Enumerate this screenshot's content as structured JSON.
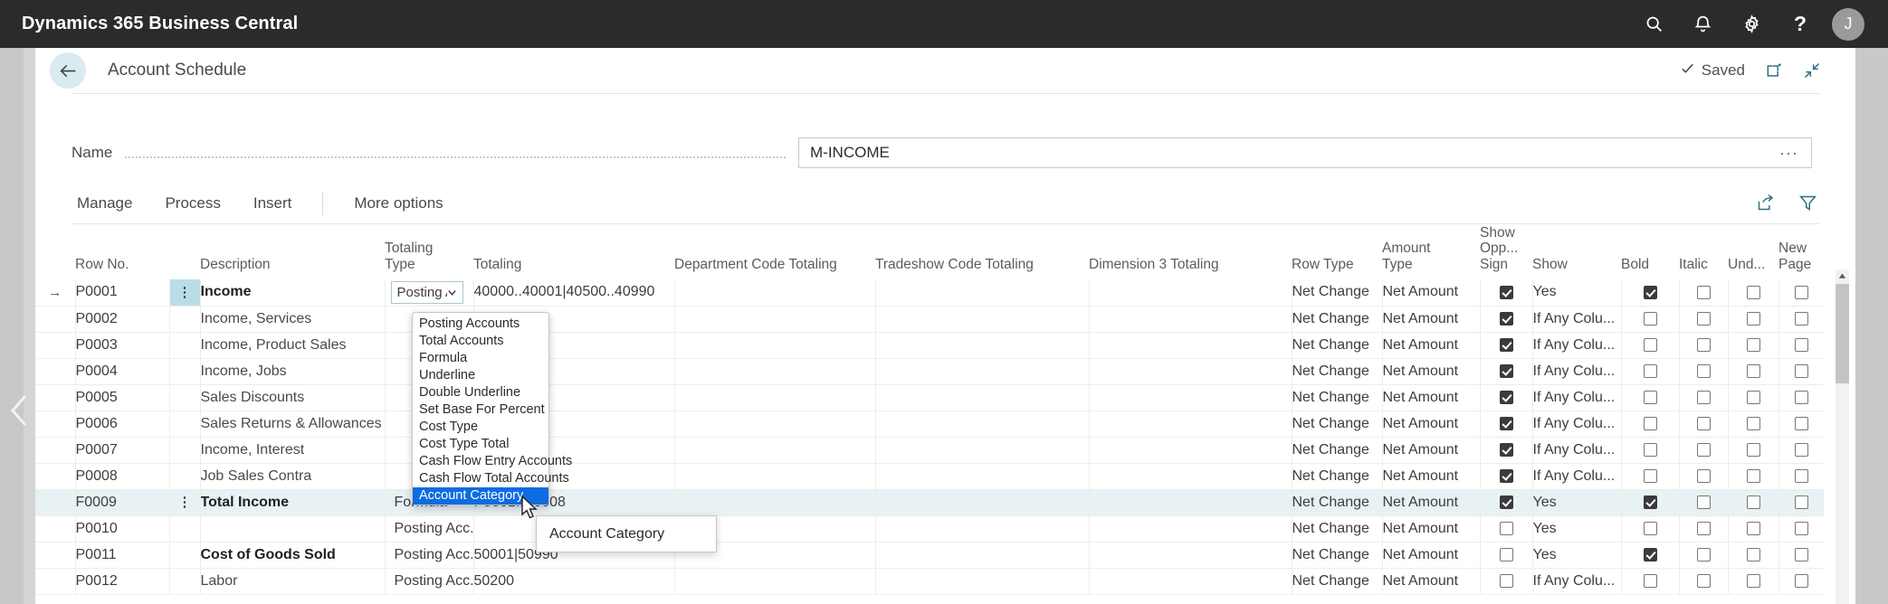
{
  "appbar": {
    "title": "Dynamics 365 Business Central",
    "icons": [
      {
        "name": "search-icon",
        "label": "Search"
      },
      {
        "name": "bell-icon",
        "label": "Notifications"
      },
      {
        "name": "gear-icon",
        "label": "Settings"
      },
      {
        "name": "help-icon",
        "label": "?"
      }
    ],
    "avatar_initial": "J",
    "background": "#2b2b2b"
  },
  "page": {
    "back_label": "Back",
    "title": "Account Schedule",
    "saved_label": "Saved",
    "open_new_window_label": "Open in new window",
    "minimize_label": "Minimize"
  },
  "name_field": {
    "label": "Name",
    "value": "M-INCOME",
    "placeholder": "",
    "ellipsis": "···"
  },
  "ribbon": {
    "items": [
      {
        "label": "Manage"
      },
      {
        "label": "Process"
      },
      {
        "label": "Insert"
      }
    ],
    "more_options": "More options",
    "right_icons": [
      {
        "name": "share-icon"
      },
      {
        "name": "filter-icon"
      }
    ]
  },
  "grid": {
    "columns": [
      {
        "key": "arrow",
        "label": ""
      },
      {
        "key": "rowno",
        "label": "Row No."
      },
      {
        "key": "kebab",
        "label": ""
      },
      {
        "key": "desc",
        "label": "Description"
      },
      {
        "key": "ttype",
        "label": "Totaling\nType"
      },
      {
        "key": "tot",
        "label": "Totaling"
      },
      {
        "key": "dept",
        "label": "Department Code Totaling"
      },
      {
        "key": "trade",
        "label": "Tradeshow Code Totaling"
      },
      {
        "key": "dim3",
        "label": "Dimension 3 Totaling"
      },
      {
        "key": "rtype",
        "label": "Row Type"
      },
      {
        "key": "atype",
        "label": "Amount\nType"
      },
      {
        "key": "showopp",
        "label": "Show\nOpp...\nSign"
      },
      {
        "key": "show",
        "label": "Show"
      },
      {
        "key": "bold",
        "label": "Bold"
      },
      {
        "key": "italic",
        "label": "Italic"
      },
      {
        "key": "und",
        "label": "Und..."
      },
      {
        "key": "newpg",
        "label": "New\nPage"
      }
    ],
    "column_labels": {
      "rowno": "Row No.",
      "desc": "Description",
      "ttype_l1": "Totaling",
      "ttype_l2": "Type",
      "tot": "Totaling",
      "dept": "Department Code Totaling",
      "trade": "Tradeshow Code Totaling",
      "dim3": "Dimension 3 Totaling",
      "rtype": "Row Type",
      "atype_l1": "Amount",
      "atype_l2": "Type",
      "showopp_l1": "Show",
      "showopp_l2": "Opp...",
      "showopp_l3": "Sign",
      "show": "Show",
      "bold": "Bold",
      "italic": "Italic",
      "und": "Und...",
      "newpg_l1": "New",
      "newpg_l2": "Page"
    },
    "rows": [
      {
        "arrow": "→",
        "rowno": "P0001",
        "kebab": true,
        "kebab_highlight": true,
        "desc": "Income",
        "bold_desc": true,
        "indent": false,
        "ttype": "Posting A",
        "ttype_combo": true,
        "tot": "40000..40001|40500..40990",
        "dept": "",
        "trade": "",
        "dim3": "",
        "rtype": "Net Change",
        "atype": "Net Amount",
        "showopp": true,
        "show": "Yes",
        "bold": true,
        "italic": false,
        "und": false,
        "newpg": false,
        "highlight": false
      },
      {
        "arrow": "",
        "rowno": "P0002",
        "kebab": false,
        "kebab_highlight": false,
        "desc": "Income, Services",
        "bold_desc": false,
        "indent": true,
        "ttype": "",
        "ttype_combo": false,
        "tot": "",
        "dept": "",
        "trade": "",
        "dim3": "",
        "rtype": "Net Change",
        "atype": "Net Amount",
        "showopp": true,
        "show": "If Any Colu...",
        "bold": false,
        "italic": false,
        "und": false,
        "newpg": false,
        "highlight": false
      },
      {
        "arrow": "",
        "rowno": "P0003",
        "kebab": false,
        "kebab_highlight": false,
        "desc": "Income, Product Sales",
        "bold_desc": false,
        "indent": true,
        "ttype": "",
        "ttype_combo": false,
        "tot": "",
        "dept": "",
        "trade": "",
        "dim3": "",
        "rtype": "Net Change",
        "atype": "Net Amount",
        "showopp": true,
        "show": "If Any Colu...",
        "bold": false,
        "italic": false,
        "und": false,
        "newpg": false,
        "highlight": false
      },
      {
        "arrow": "",
        "rowno": "P0004",
        "kebab": false,
        "kebab_highlight": false,
        "desc": "Income, Jobs",
        "bold_desc": false,
        "indent": true,
        "ttype": "",
        "ttype_combo": false,
        "tot": "",
        "dept": "",
        "trade": "",
        "dim3": "",
        "rtype": "Net Change",
        "atype": "Net Amount",
        "showopp": true,
        "show": "If Any Colu...",
        "bold": false,
        "italic": false,
        "und": false,
        "newpg": false,
        "highlight": false
      },
      {
        "arrow": "",
        "rowno": "P0005",
        "kebab": false,
        "kebab_highlight": false,
        "desc": "Sales Discounts",
        "bold_desc": false,
        "indent": true,
        "ttype": "",
        "ttype_combo": false,
        "tot": "",
        "dept": "",
        "trade": "",
        "dim3": "",
        "rtype": "Net Change",
        "atype": "Net Amount",
        "showopp": true,
        "show": "If Any Colu...",
        "bold": false,
        "italic": false,
        "und": false,
        "newpg": false,
        "highlight": false
      },
      {
        "arrow": "",
        "rowno": "P0006",
        "kebab": false,
        "kebab_highlight": false,
        "desc": "Sales Returns & Allowances",
        "bold_desc": false,
        "indent": true,
        "ttype": "",
        "ttype_combo": false,
        "tot": "",
        "dept": "",
        "trade": "",
        "dim3": "",
        "rtype": "Net Change",
        "atype": "Net Amount",
        "showopp": true,
        "show": "If Any Colu...",
        "bold": false,
        "italic": false,
        "und": false,
        "newpg": false,
        "highlight": false
      },
      {
        "arrow": "",
        "rowno": "P0007",
        "kebab": false,
        "kebab_highlight": false,
        "desc": "Income, Interest",
        "bold_desc": false,
        "indent": true,
        "ttype": "",
        "ttype_combo": false,
        "tot": "",
        "dept": "",
        "trade": "",
        "dim3": "",
        "rtype": "Net Change",
        "atype": "Net Amount",
        "showopp": true,
        "show": "If Any Colu...",
        "bold": false,
        "italic": false,
        "und": false,
        "newpg": false,
        "highlight": false
      },
      {
        "arrow": "",
        "rowno": "P0008",
        "kebab": false,
        "kebab_highlight": false,
        "desc": "Job Sales Contra",
        "bold_desc": false,
        "indent": true,
        "ttype": "",
        "ttype_combo": false,
        "tot": "",
        "dept": "",
        "trade": "",
        "dim3": "",
        "rtype": "Net Change",
        "atype": "Net Amount",
        "showopp": true,
        "show": "If Any Colu...",
        "bold": false,
        "italic": false,
        "und": false,
        "newpg": false,
        "highlight": false
      },
      {
        "arrow": "",
        "rowno": "F0009",
        "kebab": true,
        "kebab_highlight": false,
        "desc": "Total Income",
        "bold_desc": true,
        "indent": false,
        "ttype": "Formula",
        "ttype_combo": false,
        "tot": "P0001..P0008",
        "dept": "",
        "trade": "",
        "dim3": "",
        "rtype": "Net Change",
        "atype": "Net Amount",
        "showopp": true,
        "show": "Yes",
        "bold": true,
        "italic": false,
        "und": false,
        "newpg": false,
        "highlight": true
      },
      {
        "arrow": "",
        "rowno": "P0010",
        "kebab": false,
        "kebab_highlight": false,
        "desc": "",
        "bold_desc": false,
        "indent": true,
        "ttype": "Posting Acc...",
        "ttype_combo": false,
        "tot": "",
        "dept": "",
        "trade": "",
        "dim3": "",
        "rtype": "Net Change",
        "atype": "Net Amount",
        "showopp": false,
        "show": "Yes",
        "bold": false,
        "italic": false,
        "und": false,
        "newpg": false,
        "highlight": false
      },
      {
        "arrow": "",
        "rowno": "P0011",
        "kebab": false,
        "kebab_highlight": false,
        "desc": "Cost of Goods Sold",
        "bold_desc": true,
        "indent": false,
        "ttype": "Posting Acc...",
        "ttype_combo": false,
        "tot": "50001|50990",
        "dept": "",
        "trade": "",
        "dim3": "",
        "rtype": "Net Change",
        "atype": "Net Amount",
        "showopp": false,
        "show": "Yes",
        "bold": true,
        "italic": false,
        "und": false,
        "newpg": false,
        "highlight": false
      },
      {
        "arrow": "",
        "rowno": "P0012",
        "kebab": false,
        "kebab_highlight": false,
        "desc": "Labor",
        "bold_desc": false,
        "indent": true,
        "ttype": "Posting Acc...",
        "ttype_combo": false,
        "tot": "50200",
        "dept": "",
        "trade": "",
        "dim3": "",
        "rtype": "Net Change",
        "atype": "Net Amount",
        "showopp": false,
        "show": "If Any Colu...",
        "bold": false,
        "italic": false,
        "und": false,
        "newpg": false,
        "highlight": false
      }
    ]
  },
  "dropdown": {
    "options": [
      "Posting Accounts",
      "Total Accounts",
      "Formula",
      "Underline",
      "Double Underline",
      "Set Base For Percent",
      "Cost Type",
      "Cost Type Total",
      "Cash Flow Entry Accounts",
      "Cash Flow Total Accounts",
      "Account Category"
    ],
    "selected": "Account Category",
    "selected_index": 10,
    "highlight_color": "#0d6ce0"
  },
  "tooltip": {
    "text": "Account Category"
  },
  "left_nav": {
    "collapse_label": "Collapse"
  }
}
